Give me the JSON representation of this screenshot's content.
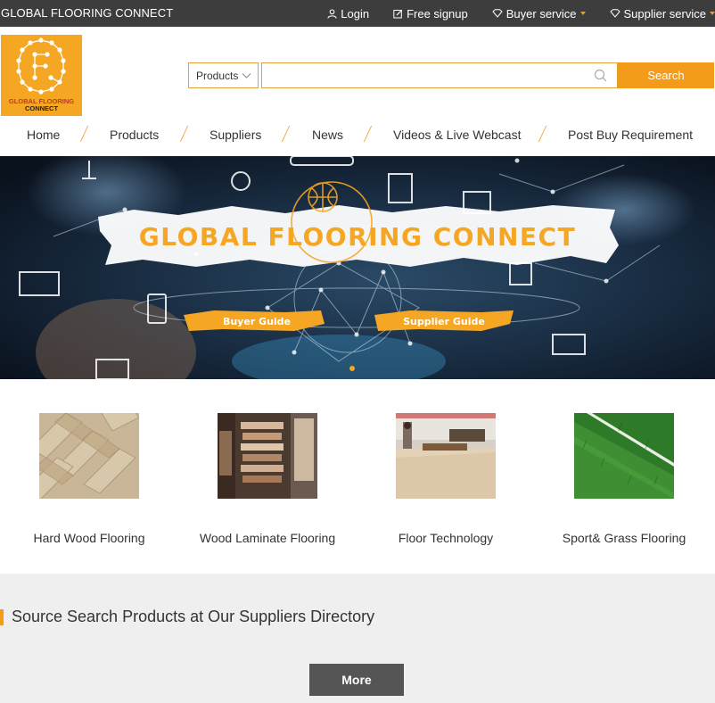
{
  "topbar": {
    "brand": "GLOBAL FLOORING CONNECT",
    "links": {
      "login": "Login",
      "signup": "Free signup",
      "buyer": "Buyer service",
      "supplier": "Supplier service"
    }
  },
  "logo": {
    "line1": "GLOBAL FLOORING",
    "line2": "CONNECT"
  },
  "search": {
    "category": "Products",
    "value": "",
    "button": "Search"
  },
  "nav": {
    "home": "Home",
    "products": "Products",
    "suppliers": "Suppliers",
    "news": "News",
    "videos": "Videos & Live Webcast",
    "post": "Post Buy Requirement"
  },
  "banner": {
    "title": "GLOBAL FLOORING CONNECT",
    "buyer_guide": "Buyer Guide",
    "supplier_guide": "Supplier Guide"
  },
  "categories": [
    {
      "label": "Hard Wood Flooring"
    },
    {
      "label": "Wood Laminate Flooring"
    },
    {
      "label": "Floor Technology"
    },
    {
      "label": "Sport& Grass Flooring"
    }
  ],
  "directory": {
    "title": "Source Search Products at Our Suppliers Directory",
    "more": "More"
  },
  "colors": {
    "accent": "#f39c1a",
    "topbar": "#3d3d3d",
    "section_bg": "#efefef"
  }
}
